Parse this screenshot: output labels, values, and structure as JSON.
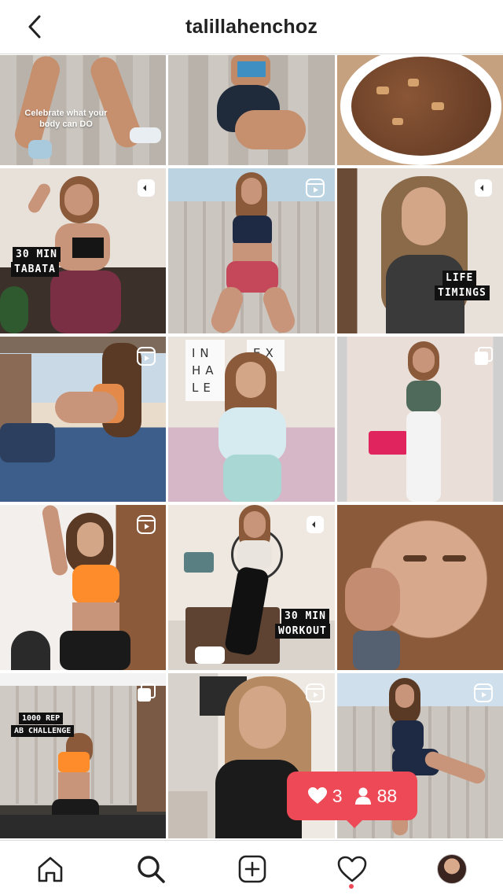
{
  "header": {
    "username": "talillahenchoz"
  },
  "icons": {
    "back": "chevron-left-icon",
    "reel": "reel-icon",
    "multi": "carousel-icon",
    "home": "home-icon",
    "search": "search-icon",
    "add": "add-post-icon",
    "activity": "heart-icon",
    "profile": "profile-avatar"
  },
  "posts": [
    {
      "caption": "Celebrate what your body can DO"
    },
    {
      "caption": ""
    },
    {
      "caption": ""
    },
    {
      "overlay": [
        "30 MIN",
        "TABATA"
      ]
    },
    {
      "overlay": []
    },
    {
      "overlay": [
        "LIFE",
        "TIMINGS"
      ]
    },
    {
      "overlay": []
    },
    {
      "poster": [
        "IN",
        "HA",
        "LE"
      ],
      "poster2": "EX"
    },
    {
      "overlay": []
    },
    {
      "overlay": []
    },
    {
      "overlay": [
        "30 MIN",
        "WORKOUT"
      ]
    },
    {
      "overlay": []
    },
    {
      "overlay": [
        "1000 REP",
        "AB CHALLENGE"
      ]
    },
    {
      "overlay": []
    },
    {
      "overlay": []
    }
  ],
  "notification": {
    "likes": "3",
    "followers": "88"
  },
  "colors": {
    "accent": "#ed4956",
    "text": "#222222",
    "divider": "#dbdbdb"
  }
}
